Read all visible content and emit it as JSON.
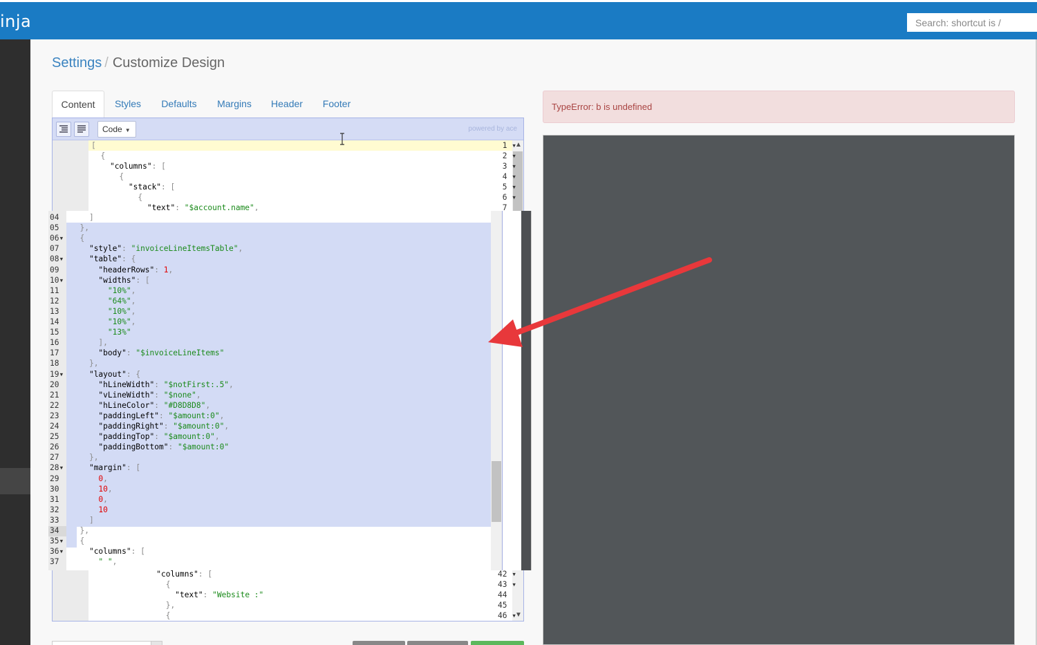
{
  "navbar": {
    "brand": "inja",
    "search_placeholder": "Search: shortcut is /"
  },
  "breadcrumb": {
    "parent": "Settings",
    "separator": "/",
    "current": "Customize Design"
  },
  "tabs": [
    {
      "label": "Content",
      "active": true
    },
    {
      "label": "Styles"
    },
    {
      "label": "Defaults"
    },
    {
      "label": "Margins"
    },
    {
      "label": "Header"
    },
    {
      "label": "Footer"
    }
  ],
  "editor": {
    "mode": "Code",
    "powered_by": "powered by ace",
    "top_lines": [
      {
        "n": "1",
        "fold": true,
        "code": "["
      },
      {
        "n": "2",
        "fold": true,
        "code": "  {"
      },
      {
        "n": "3",
        "fold": true,
        "code": "    \"columns\": ["
      },
      {
        "n": "4",
        "fold": true,
        "code": "      {"
      },
      {
        "n": "5",
        "fold": true,
        "code": "        \"stack\": ["
      },
      {
        "n": "6",
        "fold": true,
        "code": "          {"
      },
      {
        "n": "7",
        "fold": false,
        "code": "            \"text\": \"$account.name\","
      }
    ],
    "bottom_lines": [
      {
        "n": "42",
        "fold": true,
        "code": "              \"columns\": ["
      },
      {
        "n": "43",
        "fold": true,
        "code": "                {"
      },
      {
        "n": "44",
        "fold": false,
        "code": "                  \"text\": \"Website :\""
      },
      {
        "n": "45",
        "fold": false,
        "code": "                },"
      },
      {
        "n": "46",
        "fold": true,
        "code": "                {"
      }
    ]
  },
  "zoom_lines": [
    {
      "n": "04",
      "code": "  ]"
    },
    {
      "n": "05",
      "code": "},"
    },
    {
      "n": "06",
      "code": "{"
    },
    {
      "n": "07",
      "code": "  \"style\": \"invoiceLineItemsTable\","
    },
    {
      "n": "08",
      "code": "  \"table\": {"
    },
    {
      "n": "09",
      "code": "    \"headerRows\": 1,"
    },
    {
      "n": "10",
      "code": "    \"widths\": ["
    },
    {
      "n": "11",
      "code": "      \"10%\","
    },
    {
      "n": "12",
      "code": "      \"64%\","
    },
    {
      "n": "13",
      "code": "      \"10%\","
    },
    {
      "n": "14",
      "code": "      \"10%\","
    },
    {
      "n": "15",
      "code": "      \"13%\""
    },
    {
      "n": "16",
      "code": "    ],"
    },
    {
      "n": "17",
      "code": "    \"body\": \"$invoiceLineItems\""
    },
    {
      "n": "18",
      "code": "  },"
    },
    {
      "n": "19",
      "code": "  \"layout\": {"
    },
    {
      "n": "20",
      "code": "    \"hLineWidth\": \"$notFirst:.5\","
    },
    {
      "n": "21",
      "code": "    \"vLineWidth\": \"$none\","
    },
    {
      "n": "22",
      "code": "    \"hLineColor\": \"#D8D8D8\","
    },
    {
      "n": "23",
      "code": "    \"paddingLeft\": \"$amount:0\","
    },
    {
      "n": "24",
      "code": "    \"paddingRight\": \"$amount:0\","
    },
    {
      "n": "25",
      "code": "    \"paddingTop\": \"$amount:0\","
    },
    {
      "n": "26",
      "code": "    \"paddingBottom\": \"$amount:0\""
    },
    {
      "n": "27",
      "code": "  },"
    },
    {
      "n": "28",
      "code": "  \"margin\": ["
    },
    {
      "n": "29",
      "code": "    0,"
    },
    {
      "n": "30",
      "code": "    10,"
    },
    {
      "n": "31",
      "code": "    0,"
    },
    {
      "n": "32",
      "code": "    10"
    },
    {
      "n": "33",
      "code": "  ]"
    },
    {
      "n": "34",
      "code": "},"
    },
    {
      "n": "35",
      "code": "{"
    },
    {
      "n": "36",
      "code": "  \"columns\": ["
    },
    {
      "n": "37",
      "code": "    \" \","
    }
  ],
  "error": {
    "message": "TypeError: b is undefined"
  },
  "colors": {
    "navbar": "#1a7bc4",
    "link": "#337ab7",
    "selection": "#d3dbf5",
    "error_bg": "#f2dede",
    "error_text": "#a94442",
    "annotation_arrow": "#e8383b"
  }
}
